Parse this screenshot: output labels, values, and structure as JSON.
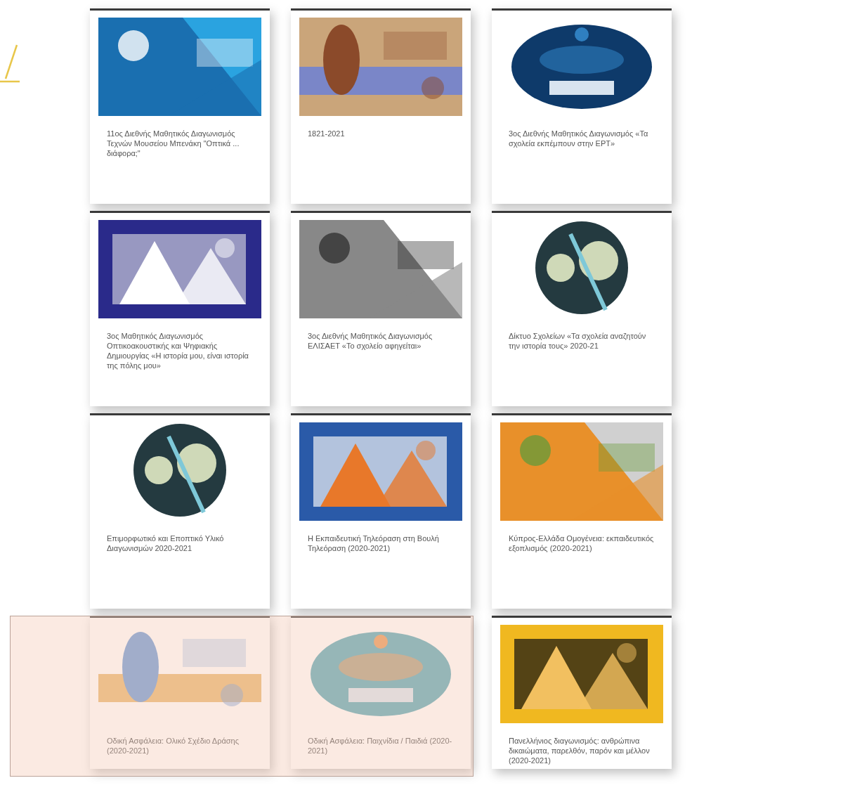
{
  "cards": [
    {
      "caption": "11ος Διεθνής Μαθητικός Διαγωνισμός Τεχνών Μουσείου Μπενάκη \"Οπτικά ... διάφορα;\""
    },
    {
      "caption": "1821-2021"
    },
    {
      "caption": "3ος Διεθνής Μαθητικός Διαγωνισμός «Τα σχολεία εκπέμπουν στην ΕΡΤ»"
    },
    {
      "caption": "3ος Μαθητικός Διαγωνισμός Οπτικοακουστικής και Ψηφιακής Δημιουργίας «Η ιστορία μου, είναι ιστορία της πόλης μου»"
    },
    {
      "caption": "3ος Διεθνής Μαθητικός Διαγωνισμός ΕΛΙΣΑΕΤ «Το σχολείο αφηγείται»"
    },
    {
      "caption": "Δίκτυο Σχολείων «Τα σχολεία αναζητούν την ιστορία τους» 2020-21"
    },
    {
      "caption": "Επιμορφωτικό και Εποπτικό Υλικό Διαγωνισμών 2020-2021"
    },
    {
      "caption": "Η Εκπαιδευτική Τηλεόραση στη Βουλή Τηλεόραση (2020-2021)"
    },
    {
      "caption": "Κύπρος-Ελλάδα Ομογένεια: εκπαιδευτικός εξοπλισμός (2020-2021)"
    },
    {
      "caption": "Οδική Ασφάλεια: Ολικό Σχέδιο Δράσης (2020-2021)"
    },
    {
      "caption": "Οδική Ασφάλεια: Παιχνίδια / Παιδιά (2020-2021)"
    },
    {
      "caption": "Πανελλήνιος διαγωνισμός: ανθρώπινα δικαιώματα, παρελθόν, παρόν και μέλλον (2020-2021)"
    }
  ]
}
